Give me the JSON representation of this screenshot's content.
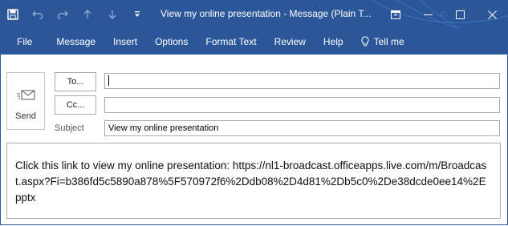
{
  "app": {
    "window_title": "View my online presentation  -  Message (Plain T...",
    "quick_access_icons": [
      "save-icon",
      "undo-icon",
      "redo-icon",
      "up-arrow-icon",
      "down-arrow-icon",
      "customize-qat-icon"
    ],
    "window_controls": [
      "ribbon-display-options-icon",
      "minimize-icon",
      "restore-icon",
      "close-icon"
    ],
    "colors": {
      "titlebar": "#2b579a",
      "text_on_bar": "#ffffff"
    }
  },
  "menu": {
    "items": [
      "File",
      "Message",
      "Insert",
      "Options",
      "Format Text",
      "Review",
      "Help"
    ],
    "tell_me": "Tell me",
    "tell_me_icon": "lightbulb-icon"
  },
  "compose": {
    "send_label": "Send",
    "to_button": "To...",
    "cc_button": "Cc...",
    "to_value": "",
    "cc_value": "",
    "subject_label": "Subject",
    "subject_value": "View my online presentation",
    "body_text": "Click this link to view my online presentation: https://nl1-broadcast.officeapps.live.com/m/Broadcast.aspx?Fi=b386fd5c5890a878%5F570972f6%2Ddb08%2D4d81%2Db5c0%2De38dcde0ee14%2Epptx"
  }
}
